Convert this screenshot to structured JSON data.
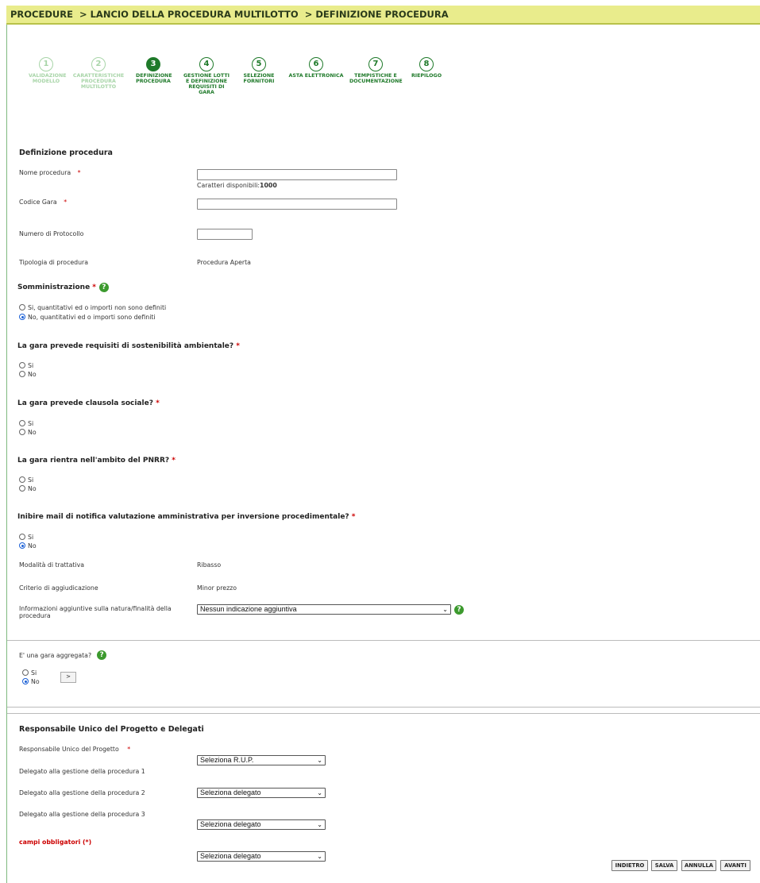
{
  "breadcrumb": {
    "items": [
      "PROCEDURE",
      "> LANCIO DELLA PROCEDURA MULTILOTTO",
      "> DEFINIZIONE PROCEDURA"
    ]
  },
  "steps": [
    {
      "num": "1",
      "label": "VALIDAZIONE MODELLO",
      "state": "done"
    },
    {
      "num": "2",
      "label": "CARATTERISTICHE PROCEDURA MULTILOTTO",
      "state": "done"
    },
    {
      "num": "3",
      "label": "DEFINIZIONE PROCEDURA",
      "state": "current"
    },
    {
      "num": "4",
      "label": "GESTIONE LOTTI E DEFINIZIONE REQUISITI DI GARA",
      "state": "todo"
    },
    {
      "num": "5",
      "label": "SELEZIONE FORNITORI",
      "state": "todo"
    },
    {
      "num": "6",
      "label": "ASTA ELETTRONICA",
      "state": "todo"
    },
    {
      "num": "7",
      "label": "TEMPISTICHE E DOCUMENTAZIONE",
      "state": "todo"
    },
    {
      "num": "8",
      "label": "RIEPILOGO",
      "state": "todo"
    }
  ],
  "definizione": {
    "title": "Definizione procedura",
    "nome_label": "Nome procedura",
    "nome_value": "",
    "caratteri_label": "Caratteri disponibili:",
    "caratteri_value": "1000",
    "codice_label": "Codice Gara",
    "codice_value": "",
    "protocollo_label": "Numero di Protocollo",
    "protocollo_value": "",
    "tipologia_label": "Tipologia di procedura",
    "tipologia_value": "Procedura Aperta",
    "required_mark": "*"
  },
  "somministrazione": {
    "title": "Somministrazione",
    "options": [
      {
        "label": "Si, quantitativi ed o importi non sono definiti",
        "selected": false
      },
      {
        "label": "No, quantitativi ed o importi sono definiti",
        "selected": true
      }
    ]
  },
  "questions": [
    {
      "title": "La gara prevede requisiti di sostenibilità ambientale?",
      "si": "Si",
      "no": "No",
      "selected": null
    },
    {
      "title": "La gara prevede clausola sociale?",
      "si": "Si",
      "no": "No",
      "selected": null
    },
    {
      "title": "La gara rientra nell'ambito del PNRR?",
      "si": "Si",
      "no": "No",
      "selected": null
    },
    {
      "title": "Inibire mail di notifica valutazione amministrativa per inversione procedimentale?",
      "si": "Si",
      "no": "No",
      "selected": "No"
    }
  ],
  "modalita": {
    "trattativa_label": "Modalità di trattativa",
    "trattativa_value": "Ribasso",
    "criterio_label": "Criterio di aggiudicazione",
    "criterio_value": "Minor prezzo",
    "info_label": "Informazioni aggiuntive sulla natura/finalità della procedura",
    "info_value": "Nessun indicazione aggiuntiva"
  },
  "aggregata": {
    "title": "E' una gara aggregata?",
    "si": "Si",
    "no": "No",
    "selected": "No",
    "go_button": ">"
  },
  "rup": {
    "title": "Responsabile Unico del Progetto e Delegati",
    "rup_label": "Responsabile Unico del Progetto",
    "rup_value": "Seleziona R.U.P.",
    "delegati": [
      {
        "label": "Delegato alla gestione della procedura  1",
        "value": "Seleziona delegato"
      },
      {
        "label": "Delegato alla gestione della procedura  2",
        "value": "Seleziona delegato"
      },
      {
        "label": "Delegato alla gestione della procedura  3",
        "value": "Seleziona delegato"
      }
    ]
  },
  "footer": {
    "obbligatori": "campi obbligatori (*)",
    "buttons": {
      "indietro": "INDIETRO",
      "salva": "SALVA",
      "annulla": "ANNULLA",
      "avanti": "AVANTI"
    }
  },
  "colors": {
    "header_bg": "#e9ec8c",
    "green": "#1f7a2a",
    "help_green": "#3c9a2e",
    "required": "#cc0000"
  }
}
